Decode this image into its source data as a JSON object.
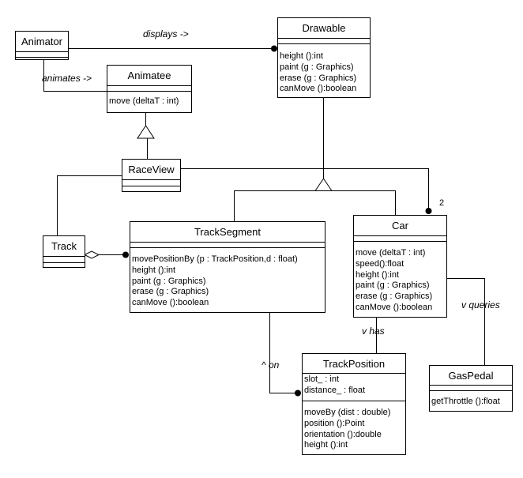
{
  "diagram": {
    "type": "UML class diagram",
    "classes": {
      "animator": {
        "name": "Animator",
        "attributes": [],
        "operations": []
      },
      "animatee": {
        "name": "Animatee",
        "attributes": [],
        "operations": [
          "move (deltaT : int)"
        ]
      },
      "drawable": {
        "name": "Drawable",
        "attributes": [],
        "operations": [
          "height ():int",
          "paint (g : Graphics)",
          "erase (g : Graphics)",
          "canMove ():boolean"
        ]
      },
      "raceview": {
        "name": "RaceView",
        "attributes": [],
        "operations": []
      },
      "track": {
        "name": "Track",
        "attributes": [],
        "operations": []
      },
      "tracksegment": {
        "name": "TrackSegment",
        "attributes": [],
        "operations": [
          "movePositionBy (p : TrackPosition,d : float)",
          "height ():int",
          "paint (g : Graphics)",
          "erase (g : Graphics)",
          "canMove ():boolean"
        ]
      },
      "car": {
        "name": "Car",
        "attributes": [],
        "operations": [
          "move (deltaT : int)",
          "speed():float",
          "height ():int",
          "paint (g : Graphics)",
          "erase (g : Graphics)",
          "canMove ():boolean"
        ]
      },
      "trackposition": {
        "name": "TrackPosition",
        "attributes": [
          "slot_ : int",
          "distance_ : float"
        ],
        "operations": [
          "moveBy (dist : double)",
          "position ():Point",
          "orientation ():double",
          "height ():int"
        ]
      },
      "gaspedal": {
        "name": "GasPedal",
        "attributes": [],
        "operations": [
          "getThrottle ():float"
        ]
      }
    },
    "relations": [
      {
        "from": "Animator",
        "to": "Drawable",
        "kind": "association",
        "label": "displays ->"
      },
      {
        "from": "Animator",
        "to": "Animatee",
        "kind": "association",
        "label": "animates ->"
      },
      {
        "from": "RaceView",
        "to": "Animatee",
        "kind": "generalization",
        "label": ""
      },
      {
        "from": "TrackSegment",
        "to": "Drawable",
        "kind": "generalization",
        "label": ""
      },
      {
        "from": "Car",
        "to": "Drawable",
        "kind": "generalization",
        "label": ""
      },
      {
        "from": "RaceView",
        "to": "Car",
        "kind": "association",
        "label": "",
        "multiplicity": "2"
      },
      {
        "from": "RaceView",
        "to": "Track",
        "kind": "association",
        "label": ""
      },
      {
        "from": "Track",
        "to": "TrackSegment",
        "kind": "aggregation",
        "label": ""
      },
      {
        "from": "TrackSegment",
        "to": "TrackPosition",
        "kind": "association",
        "label": "^ on"
      },
      {
        "from": "Car",
        "to": "TrackPosition",
        "kind": "association",
        "label": "v has"
      },
      {
        "from": "Car",
        "to": "GasPedal",
        "kind": "association",
        "label": "v queries"
      }
    ],
    "labels": {
      "displays": "displays ->",
      "animates": "animates ->",
      "has": "v has",
      "on": "^ on",
      "queries": "v queries",
      "car_multiplicity": "2"
    }
  }
}
